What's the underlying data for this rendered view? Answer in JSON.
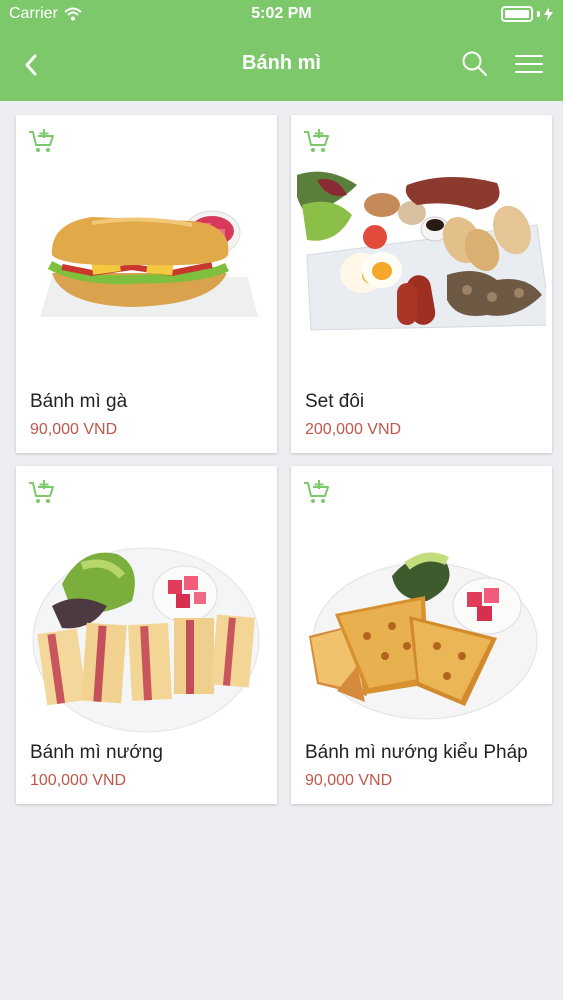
{
  "status_bar": {
    "carrier": "Carrier",
    "time": "5:02 PM"
  },
  "nav": {
    "title": "Bánh mì",
    "back_icon": "chevron-left-icon",
    "search_icon": "search-icon",
    "menu_icon": "hamburger-menu-icon"
  },
  "colors": {
    "accent": "#7cc86a",
    "price": "#c0574a",
    "background": "#eceef1"
  },
  "products": [
    {
      "name": "Bánh mì gà",
      "price": "90,000 VND"
    },
    {
      "name": "Set đôi",
      "price": "200,000 VND"
    },
    {
      "name": "Bánh mì nướng",
      "price": "100,000 VND"
    },
    {
      "name": "Bánh mì nướng kiểu Pháp",
      "price": "90,000 VND"
    }
  ]
}
